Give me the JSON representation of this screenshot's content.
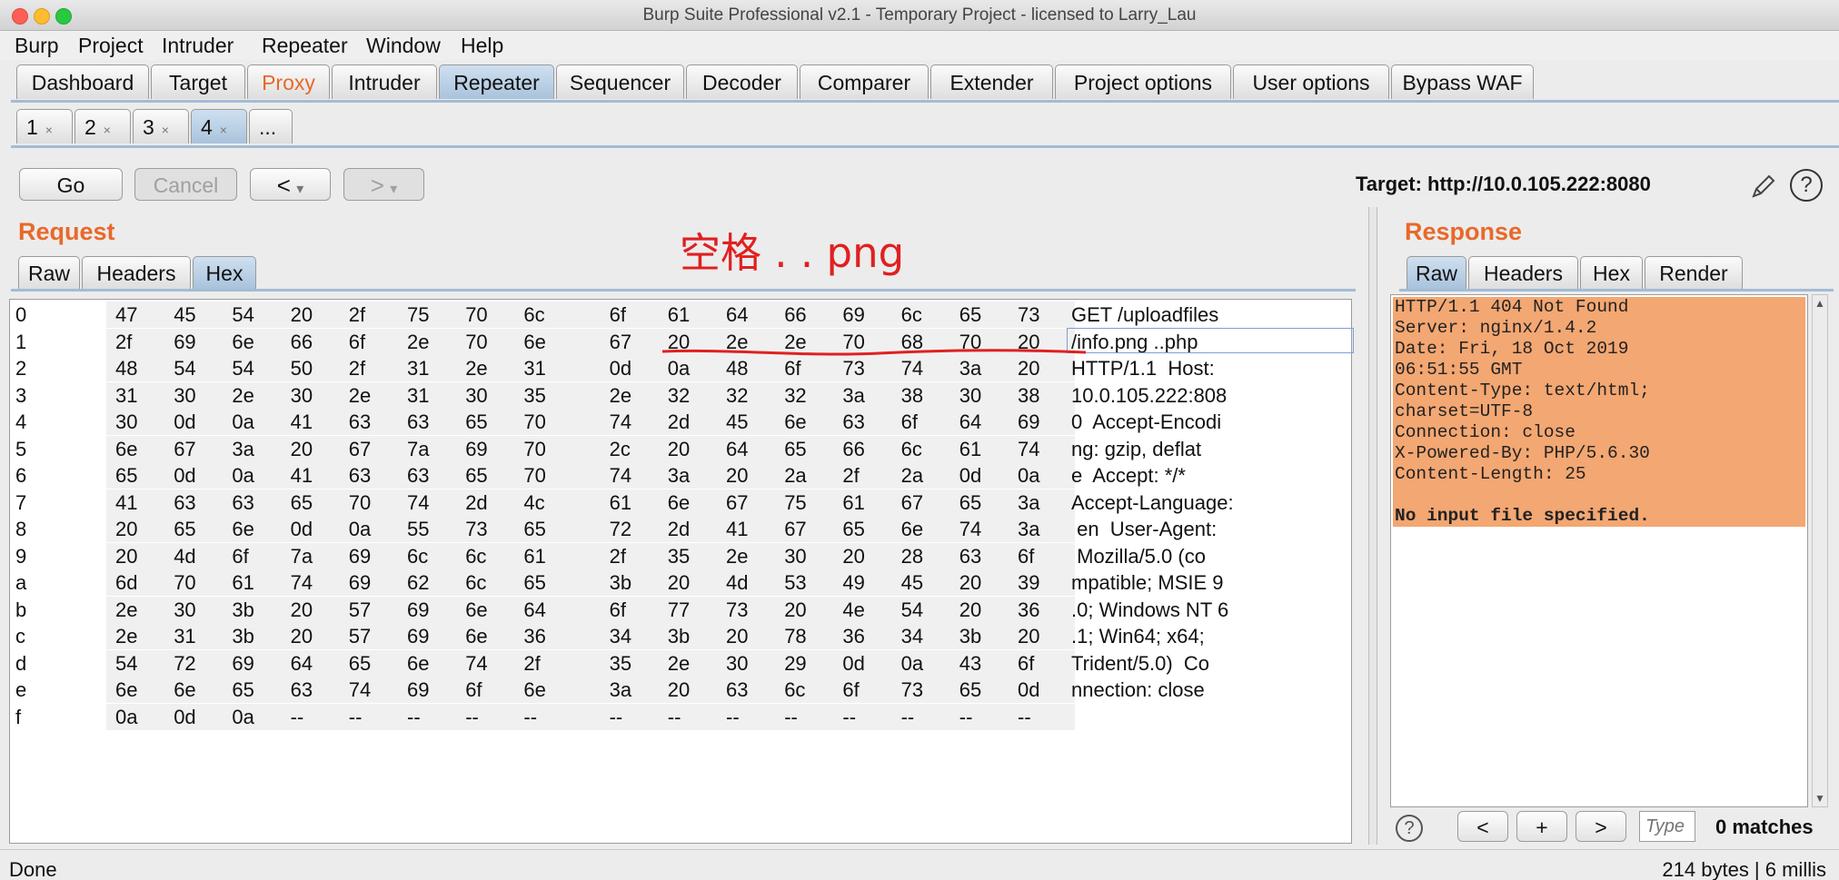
{
  "window": {
    "title": "Burp Suite Professional v2.1 - Temporary Project - licensed to Larry_Lau"
  },
  "menu": [
    "Burp",
    "Project",
    "Intruder",
    "Repeater",
    "Window",
    "Help"
  ],
  "tabs": [
    "Dashboard",
    "Target",
    "Proxy",
    "Intruder",
    "Repeater",
    "Sequencer",
    "Decoder",
    "Comparer",
    "Extender",
    "Project options",
    "User options",
    "Bypass WAF"
  ],
  "selected_tab": "Repeater",
  "repeater_tabs": [
    "1",
    "2",
    "3",
    "4",
    "..."
  ],
  "subtab_close": "×",
  "toolbar": {
    "go": "Go",
    "cancel": "Cancel",
    "back": "<",
    "forward": ">",
    "dropdown": "▾"
  },
  "target": {
    "label": "Target: http://10.0.105.222:8080"
  },
  "request": {
    "title": "Request",
    "tabs": [
      "Raw",
      "Headers",
      "Hex"
    ],
    "selected": "Hex"
  },
  "annotation": {
    "text": "空格 . . png"
  },
  "hex_rows": [
    {
      "offset": "0",
      "bytes": [
        "47",
        "45",
        "54",
        "20",
        "2f",
        "75",
        "70",
        "6c",
        "6f",
        "61",
        "64",
        "66",
        "69",
        "6c",
        "65",
        "73"
      ],
      "ascii": "GET /uploadfiles"
    },
    {
      "offset": "1",
      "bytes": [
        "2f",
        "69",
        "6e",
        "66",
        "6f",
        "2e",
        "70",
        "6e",
        "67",
        "20",
        "2e",
        "2e",
        "70",
        "68",
        "70",
        "20"
      ],
      "ascii": "/info.png ..php"
    },
    {
      "offset": "2",
      "bytes": [
        "48",
        "54",
        "54",
        "50",
        "2f",
        "31",
        "2e",
        "31",
        "0d",
        "0a",
        "48",
        "6f",
        "73",
        "74",
        "3a",
        "20"
      ],
      "ascii": "HTTP/1.1  Host:"
    },
    {
      "offset": "3",
      "bytes": [
        "31",
        "30",
        "2e",
        "30",
        "2e",
        "31",
        "30",
        "35",
        "2e",
        "32",
        "32",
        "32",
        "3a",
        "38",
        "30",
        "38"
      ],
      "ascii": "10.0.105.222:808"
    },
    {
      "offset": "4",
      "bytes": [
        "30",
        "0d",
        "0a",
        "41",
        "63",
        "63",
        "65",
        "70",
        "74",
        "2d",
        "45",
        "6e",
        "63",
        "6f",
        "64",
        "69"
      ],
      "ascii": "0  Accept-Encodi"
    },
    {
      "offset": "5",
      "bytes": [
        "6e",
        "67",
        "3a",
        "20",
        "67",
        "7a",
        "69",
        "70",
        "2c",
        "20",
        "64",
        "65",
        "66",
        "6c",
        "61",
        "74"
      ],
      "ascii": "ng: gzip, deflat"
    },
    {
      "offset": "6",
      "bytes": [
        "65",
        "0d",
        "0a",
        "41",
        "63",
        "63",
        "65",
        "70",
        "74",
        "3a",
        "20",
        "2a",
        "2f",
        "2a",
        "0d",
        "0a"
      ],
      "ascii": "e  Accept: */*"
    },
    {
      "offset": "7",
      "bytes": [
        "41",
        "63",
        "63",
        "65",
        "70",
        "74",
        "2d",
        "4c",
        "61",
        "6e",
        "67",
        "75",
        "61",
        "67",
        "65",
        "3a"
      ],
      "ascii": "Accept-Language:"
    },
    {
      "offset": "8",
      "bytes": [
        "20",
        "65",
        "6e",
        "0d",
        "0a",
        "55",
        "73",
        "65",
        "72",
        "2d",
        "41",
        "67",
        "65",
        "6e",
        "74",
        "3a"
      ],
      "ascii": " en  User-Agent:"
    },
    {
      "offset": "9",
      "bytes": [
        "20",
        "4d",
        "6f",
        "7a",
        "69",
        "6c",
        "6c",
        "61",
        "2f",
        "35",
        "2e",
        "30",
        "20",
        "28",
        "63",
        "6f"
      ],
      "ascii": " Mozilla/5.0 (co"
    },
    {
      "offset": "a",
      "bytes": [
        "6d",
        "70",
        "61",
        "74",
        "69",
        "62",
        "6c",
        "65",
        "3b",
        "20",
        "4d",
        "53",
        "49",
        "45",
        "20",
        "39"
      ],
      "ascii": "mpatible; MSIE 9"
    },
    {
      "offset": "b",
      "bytes": [
        "2e",
        "30",
        "3b",
        "20",
        "57",
        "69",
        "6e",
        "64",
        "6f",
        "77",
        "73",
        "20",
        "4e",
        "54",
        "20",
        "36"
      ],
      "ascii": ".0; Windows NT 6"
    },
    {
      "offset": "c",
      "bytes": [
        "2e",
        "31",
        "3b",
        "20",
        "57",
        "69",
        "6e",
        "36",
        "34",
        "3b",
        "20",
        "78",
        "36",
        "34",
        "3b",
        "20"
      ],
      "ascii": ".1; Win64; x64;"
    },
    {
      "offset": "d",
      "bytes": [
        "54",
        "72",
        "69",
        "64",
        "65",
        "6e",
        "74",
        "2f",
        "35",
        "2e",
        "30",
        "29",
        "0d",
        "0a",
        "43",
        "6f"
      ],
      "ascii": "Trident/5.0)  Co"
    },
    {
      "offset": "e",
      "bytes": [
        "6e",
        "6e",
        "65",
        "63",
        "74",
        "69",
        "6f",
        "6e",
        "3a",
        "20",
        "63",
        "6c",
        "6f",
        "73",
        "65",
        "0d"
      ],
      "ascii": "nnection: close"
    },
    {
      "offset": "f",
      "bytes": [
        "0a",
        "0d",
        "0a",
        "--",
        "--",
        "--",
        "--",
        "--",
        "--",
        "--",
        "--",
        "--",
        "--",
        "--",
        "--",
        "--"
      ],
      "ascii": ""
    }
  ],
  "response": {
    "title": "Response",
    "tabs": [
      "Raw",
      "Headers",
      "Hex",
      "Render"
    ],
    "selected": "Raw",
    "lines": [
      "HTTP/1.1 404 Not Found",
      "Server: nginx/1.4.2",
      "Date: Fri, 18 Oct 2019",
      "06:51:55 GMT",
      "Content-Type: text/html;",
      "charset=UTF-8",
      "Connection: close",
      "X-Powered-By: PHP/5.6.30",
      "Content-Length: 25",
      "",
      "No input file specified."
    ]
  },
  "search": {
    "help": "?",
    "prev": "<",
    "add": "+",
    "next": ">",
    "placeholder": "Type",
    "matches": "0 matches"
  },
  "status": {
    "left": "Done",
    "right": "214 bytes | 6 millis"
  },
  "colors": {
    "accent": "#e8692a",
    "selected_tab": "#b7cde3",
    "response_highlight": "#f3a772",
    "annotation": "#e02020"
  }
}
